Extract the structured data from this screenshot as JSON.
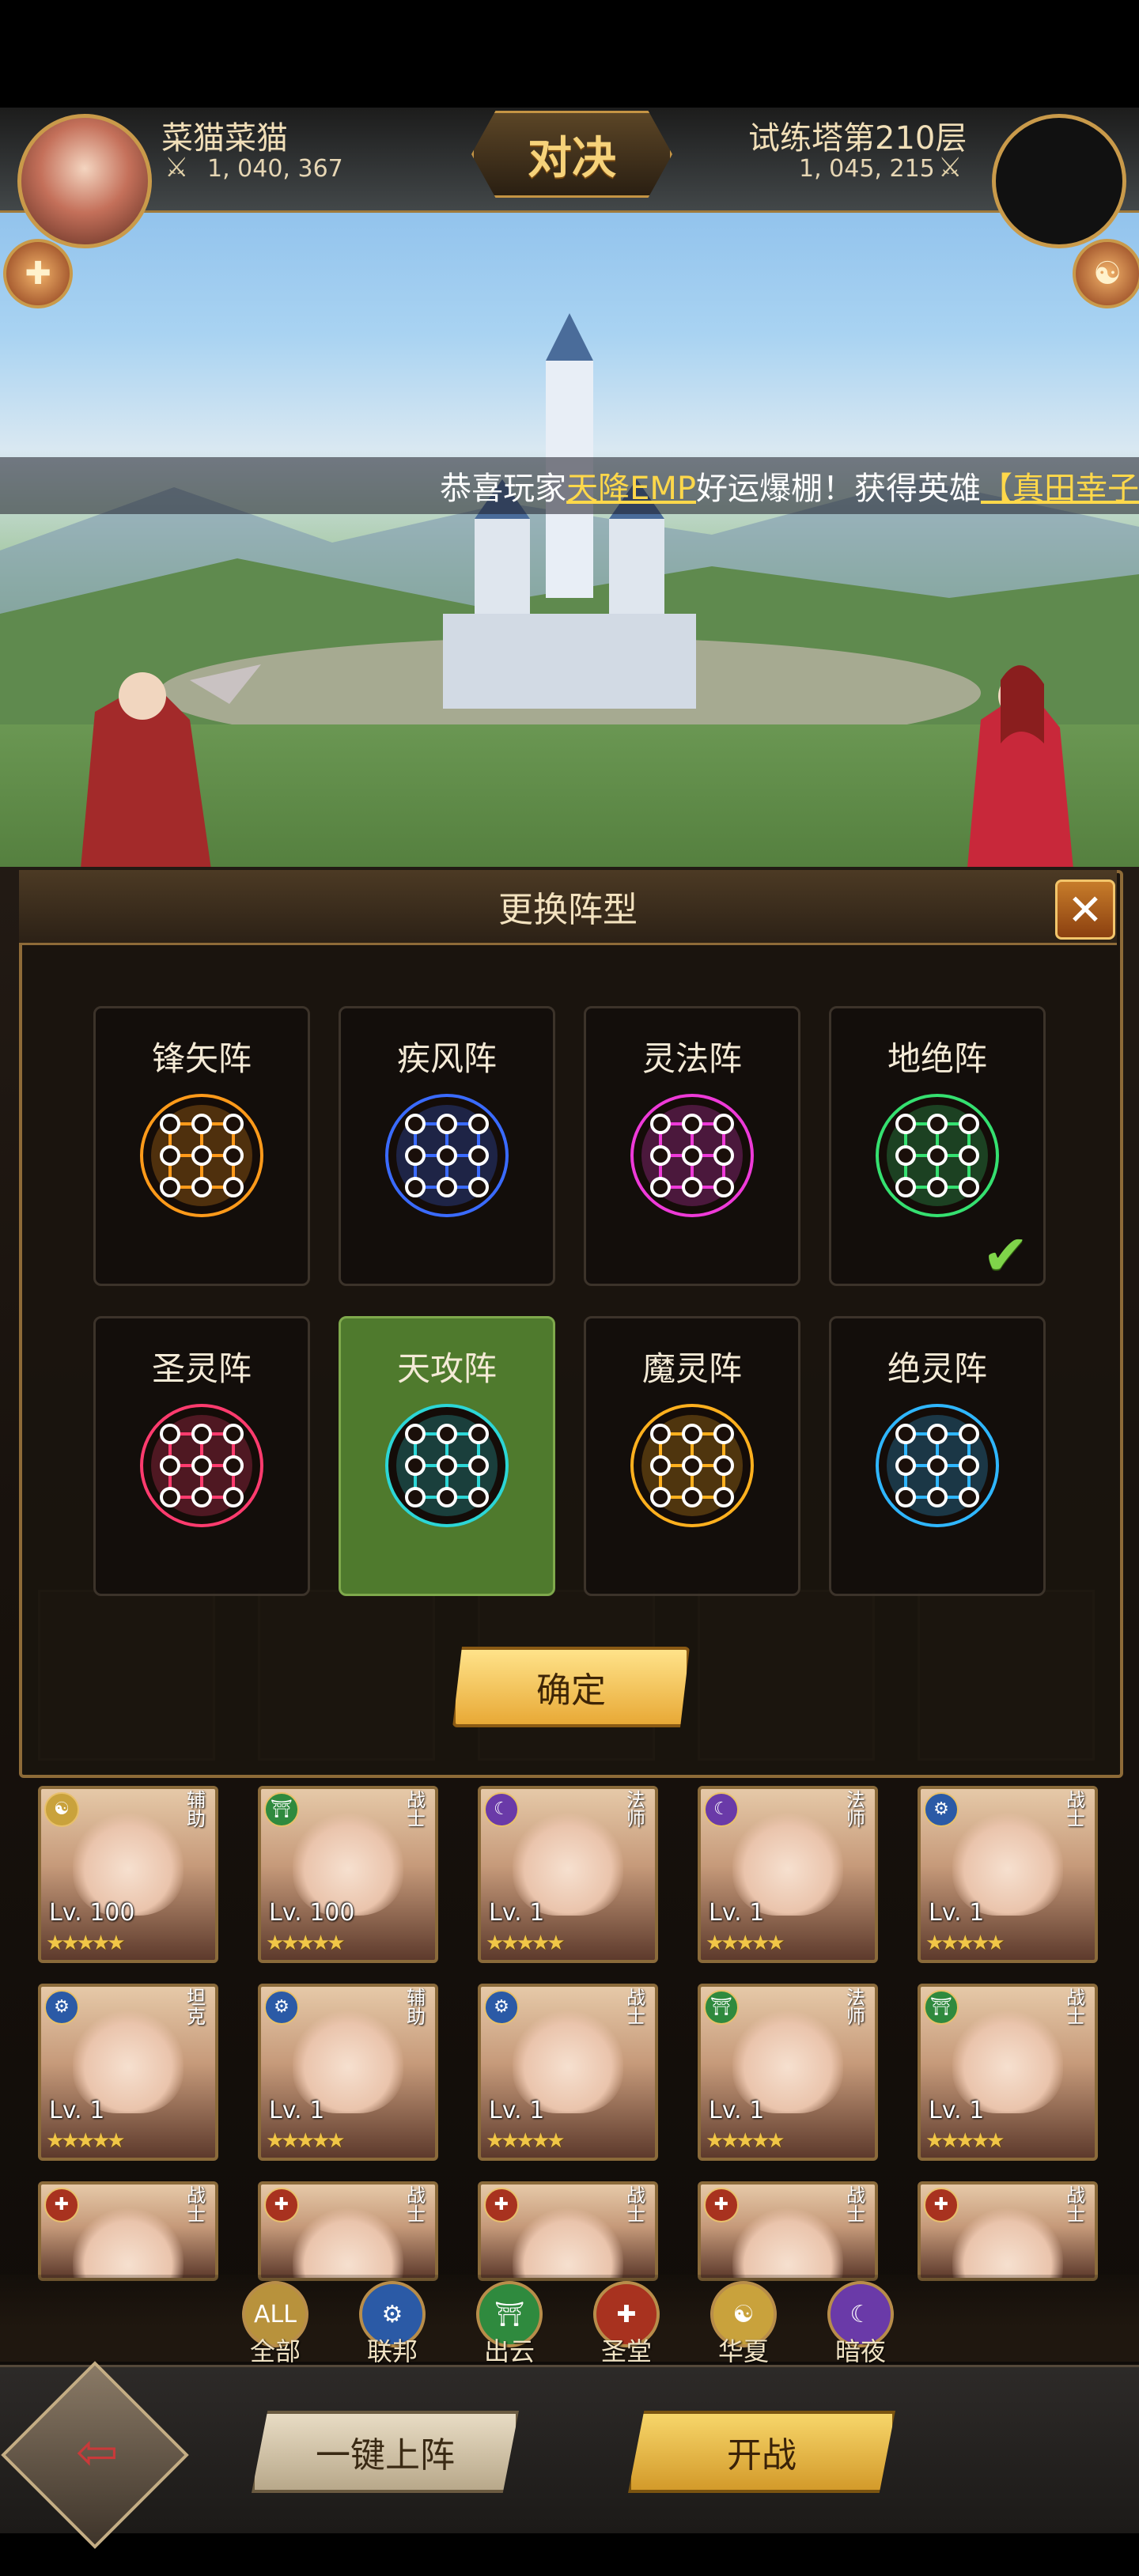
{
  "header": {
    "player_name": "菜猫菜猫",
    "player_power": "1, 040, 367",
    "opponent_name": "试练塔第210层",
    "opponent_power": "1, 045, 215",
    "vs_label": "对决"
  },
  "marquee": {
    "prefix": "恭喜玩家",
    "player": "天降EMP",
    "middle": "好运爆棚！获得英雄",
    "hero": "【真田幸子"
  },
  "modal": {
    "title": "更换阵型",
    "confirm_label": "确定",
    "formations": [
      {
        "name": "锋矢阵",
        "color": "#ff9a1a",
        "selected": false
      },
      {
        "name": "疾风阵",
        "color": "#3a6bff",
        "selected": false
      },
      {
        "name": "灵法阵",
        "color": "#ee3ad8",
        "selected": false
      },
      {
        "name": "地绝阵",
        "color": "#35e070",
        "selected": false
      },
      {
        "name": "圣灵阵",
        "color": "#ff3b6e",
        "selected": false
      },
      {
        "name": "天攻阵",
        "color": "#2cd6d6",
        "selected": true
      },
      {
        "name": "魔灵阵",
        "color": "#ffb01e",
        "selected": false
      },
      {
        "name": "绝灵阵",
        "color": "#2fb6ff",
        "selected": false
      }
    ]
  },
  "roster": [
    {
      "level": "Lv. 100",
      "role": "辅助",
      "faction": "华夏"
    },
    {
      "level": "Lv. 100",
      "role": "战士",
      "faction": "出云"
    },
    {
      "level": "Lv. 1",
      "role": "法师",
      "faction": "暗夜"
    },
    {
      "level": "Lv. 1",
      "role": "法师",
      "faction": "暗夜"
    },
    {
      "level": "Lv. 1",
      "role": "战士",
      "faction": "联邦"
    },
    {
      "level": "Lv. 1",
      "role": "坦克",
      "faction": "联邦"
    },
    {
      "level": "Lv. 1",
      "role": "辅助",
      "faction": "联邦"
    },
    {
      "level": "Lv. 1",
      "role": "战士",
      "faction": "联邦"
    },
    {
      "level": "Lv. 1",
      "role": "法师",
      "faction": "出云"
    },
    {
      "level": "Lv. 1",
      "role": "战士",
      "faction": "出云"
    },
    {
      "level": "",
      "role": "战士",
      "faction": "圣堂"
    },
    {
      "level": "",
      "role": "战士",
      "faction": "圣堂"
    },
    {
      "level": "",
      "role": "战士",
      "faction": "圣堂"
    },
    {
      "level": "",
      "role": "战士",
      "faction": "圣堂"
    },
    {
      "level": "",
      "role": "战士",
      "faction": "圣堂"
    }
  ],
  "filters": [
    {
      "label": "全部",
      "badge": "ALL",
      "color": "#b8923c"
    },
    {
      "label": "联邦",
      "badge": "⚙",
      "color": "#2b5aa6"
    },
    {
      "label": "出云",
      "badge": "⛩",
      "color": "#2f8a3e"
    },
    {
      "label": "圣堂",
      "badge": "✚",
      "color": "#a8321f"
    },
    {
      "label": "华夏",
      "badge": "☯",
      "color": "#c9a23c"
    },
    {
      "label": "暗夜",
      "badge": "☾",
      "color": "#6a3aa8"
    }
  ],
  "bottom": {
    "auto_deploy_label": "一键上阵",
    "battle_label": "开战"
  }
}
